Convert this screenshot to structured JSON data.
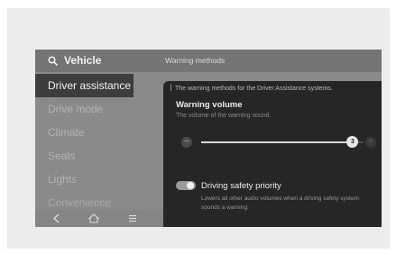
{
  "header": {
    "app_title": "Vehicle",
    "section_title": "Warning methods"
  },
  "sidebar": {
    "items": [
      {
        "label": "Driver assistance",
        "active": true
      },
      {
        "label": "Drive mode"
      },
      {
        "label": "Climate"
      },
      {
        "label": "Seats"
      },
      {
        "label": "Lights"
      },
      {
        "label": "Convenience"
      }
    ]
  },
  "bottom_nav": {
    "icons": [
      "back-icon",
      "home-icon",
      "menu-icon"
    ]
  },
  "panel": {
    "description": "The warning methods for the Driver Assistance systems.",
    "warning_volume": {
      "title": "Warning volume",
      "subtitle": "The volume of the warning sound.",
      "value": "3",
      "level": 0.93,
      "minus": "−",
      "plus": "+"
    },
    "driving_safety_priority": {
      "label": "Driving safety priority",
      "enabled": true,
      "description": "Lowers all other audio volumes when a driving safety system sounds a warning."
    }
  },
  "colors": {
    "screen_bg": "#8a8a8a",
    "panel_bg": "#262626",
    "active_item_bg": "#3d3d3d",
    "text_light": "#f2f2f2"
  }
}
